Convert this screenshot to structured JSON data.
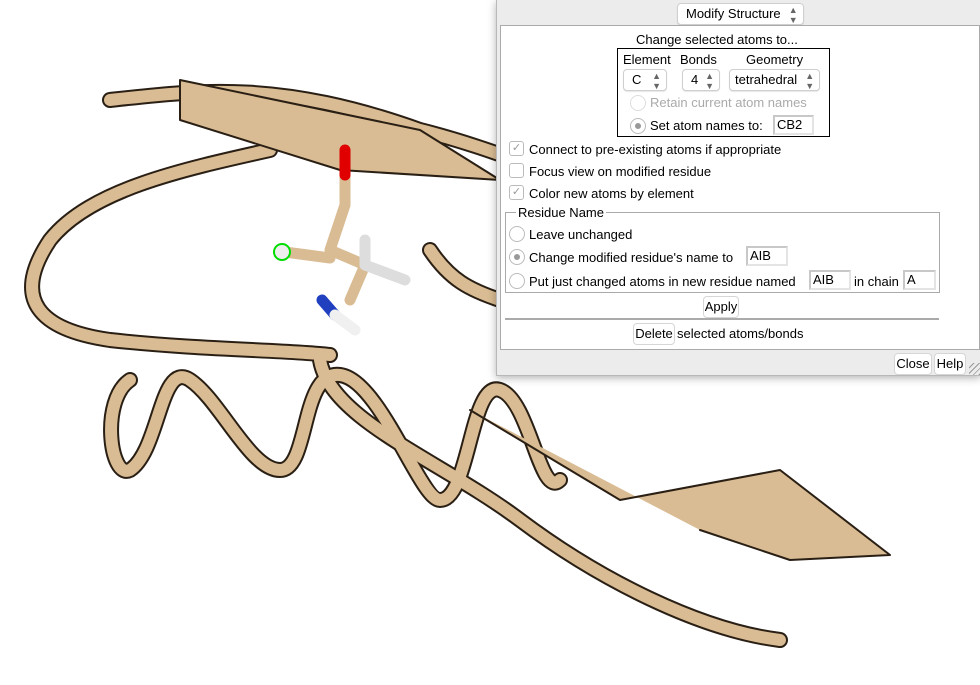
{
  "dialog": {
    "tool_menu": "Modify Structure",
    "section_title": "Change selected atoms to...",
    "element_label": "Element",
    "bonds_label": "Bonds",
    "geometry_label": "Geometry",
    "element_value": "C",
    "bonds_value": "4",
    "geometry_value": "tetrahedral",
    "retain_names_label": "Retain current atom names",
    "set_names_label": "Set atom names to:",
    "set_names_value": "CB2",
    "connect_label": "Connect to pre-existing atoms if appropriate",
    "connect_checked": true,
    "focus_label": "Focus view on modified residue",
    "focus_checked": false,
    "color_label": "Color new atoms by element",
    "color_checked": true,
    "residue_group_title": "Residue Name",
    "leave_unchanged_label": "Leave unchanged",
    "change_name_label": "Change modified residue's name to",
    "change_name_value": "AIB",
    "new_residue_label": "Put just changed atoms in new residue named",
    "new_residue_value": "AIB",
    "in_chain_label": "in chain",
    "chain_value": "A",
    "apply_label": "Apply",
    "delete_label": "Delete",
    "delete_suffix": "selected atoms/bonds",
    "close_label": "Close",
    "help_label": "Help"
  },
  "colors": {
    "ribbon": "#d9bc93",
    "oxygen": "#e00000",
    "nitrogen": "#2040c0",
    "hydrogen": "#ffffff",
    "selection": "#00dd00"
  }
}
